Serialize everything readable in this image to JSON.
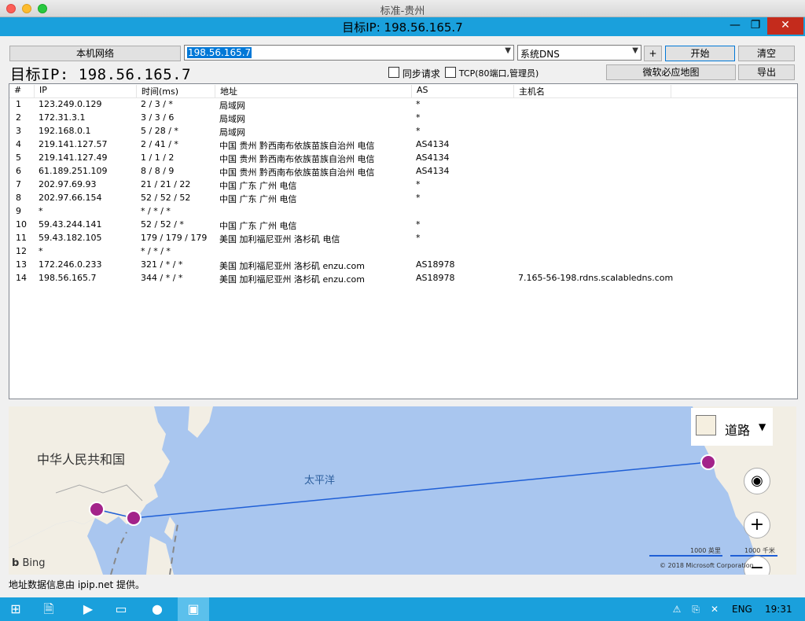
{
  "mac_title": "标准-贵州",
  "window_title": "目标IP: 198.56.165.7",
  "toolbar": {
    "local_network": "本机网络",
    "target_input": "198.56.165.7",
    "dns_select": "系统DNS",
    "add": "+",
    "start": "开始",
    "clear": "清空",
    "sync_request": "同步请求",
    "tcp": "TCP(80端口,管理员)",
    "bing_map": "微软必应地图",
    "export": "导出"
  },
  "target_label": "目标IP: 198.56.165.7",
  "columns": [
    "#",
    "IP",
    "时间(ms)",
    "地址",
    "AS",
    "主机名"
  ],
  "rows": [
    {
      "n": "1",
      "ip": "123.249.0.129",
      "time": "2 / 3 / *",
      "addr": "局域网",
      "as": "*",
      "host": ""
    },
    {
      "n": "2",
      "ip": "172.31.3.1",
      "time": "3 / 3 / 6",
      "addr": "局域网",
      "as": "*",
      "host": ""
    },
    {
      "n": "3",
      "ip": "192.168.0.1",
      "time": "5 / 28 / *",
      "addr": "局域网",
      "as": "*",
      "host": ""
    },
    {
      "n": "4",
      "ip": "219.141.127.57",
      "time": "2 / 41 / *",
      "addr": "中国 贵州 黔西南布依族苗族自治州 电信",
      "as": "AS4134",
      "host": ""
    },
    {
      "n": "5",
      "ip": "219.141.127.49",
      "time": "1 / 1 / 2",
      "addr": "中国 贵州 黔西南布依族苗族自治州 电信",
      "as": "AS4134",
      "host": ""
    },
    {
      "n": "6",
      "ip": "61.189.251.109",
      "time": "8 / 8 / 9",
      "addr": "中国 贵州 黔西南布依族苗族自治州 电信",
      "as": "AS4134",
      "host": ""
    },
    {
      "n": "7",
      "ip": "202.97.69.93",
      "time": "21 / 21 / 22",
      "addr": "中国 广东 广州 电信",
      "as": "*",
      "host": ""
    },
    {
      "n": "8",
      "ip": "202.97.66.154",
      "time": "52 / 52 / 52",
      "addr": "中国 广东 广州 电信",
      "as": "*",
      "host": ""
    },
    {
      "n": "9",
      "ip": "*",
      "time": "* / * / *",
      "addr": "",
      "as": "",
      "host": ""
    },
    {
      "n": "10",
      "ip": "59.43.244.141",
      "time": "52 / 52 / *",
      "addr": "中国 广东 广州 电信",
      "as": "*",
      "host": ""
    },
    {
      "n": "11",
      "ip": "59.43.182.105",
      "time": "179 / 179 / 179",
      "addr": "美国 加利福尼亚州 洛杉矶 电信",
      "as": "*",
      "host": ""
    },
    {
      "n": "12",
      "ip": "*",
      "time": "* / * / *",
      "addr": "",
      "as": "",
      "host": ""
    },
    {
      "n": "13",
      "ip": "172.246.0.233",
      "time": "321 / * / *",
      "addr": "美国 加利福尼亚州 洛杉矶 enzu.com",
      "as": "AS18978",
      "host": ""
    },
    {
      "n": "14",
      "ip": "198.56.165.7",
      "time": "344 / * / *",
      "addr": "美国 加利福尼亚州 洛杉矶 enzu.com",
      "as": "AS18978",
      "host": "7.165-56-198.rdns.scalabledns.com"
    }
  ],
  "map": {
    "country_label": "中华人民共和国",
    "ocean_label": "太平洋",
    "road_label": "道路",
    "bing": "Bing",
    "scale_miles": "1000 英里",
    "scale_km": "1000 千米",
    "copyright": "© 2018 Microsoft Corporation"
  },
  "status_text": "地址数据信息由 ipip.net 提供。",
  "taskbar": {
    "lang": "ENG",
    "time": "19:31"
  }
}
